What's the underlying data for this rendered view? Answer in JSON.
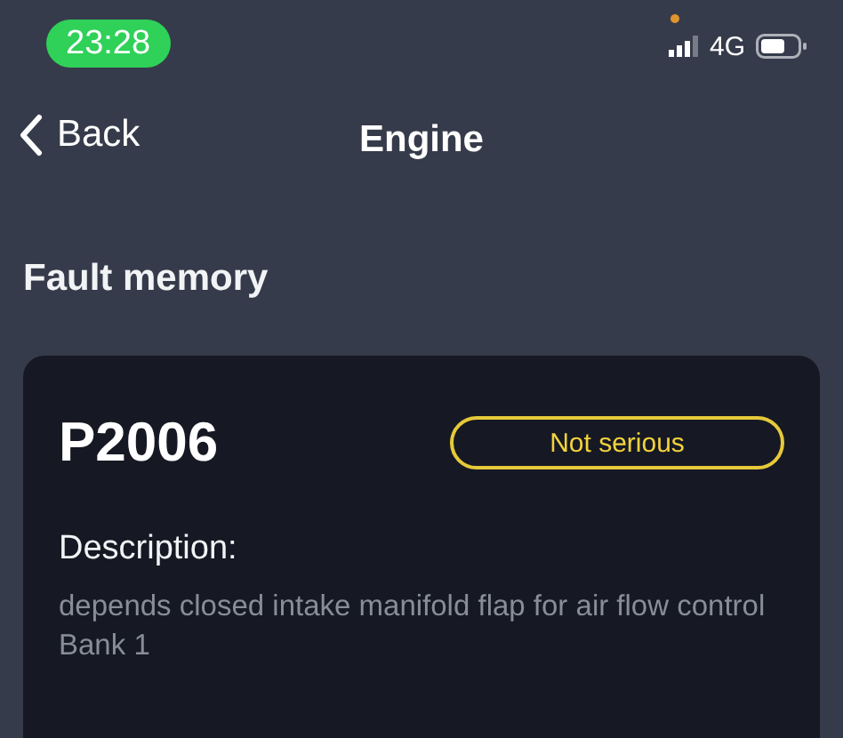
{
  "status_bar": {
    "time": "23:28",
    "network": "4G"
  },
  "nav": {
    "back": "Back",
    "title": "Engine"
  },
  "section_title": "Fault memory",
  "fault": {
    "code": "P2006",
    "severity": "Not serious",
    "description_label": "Description:",
    "description": "depends closed intake manifold flap for air flow control Bank 1"
  }
}
